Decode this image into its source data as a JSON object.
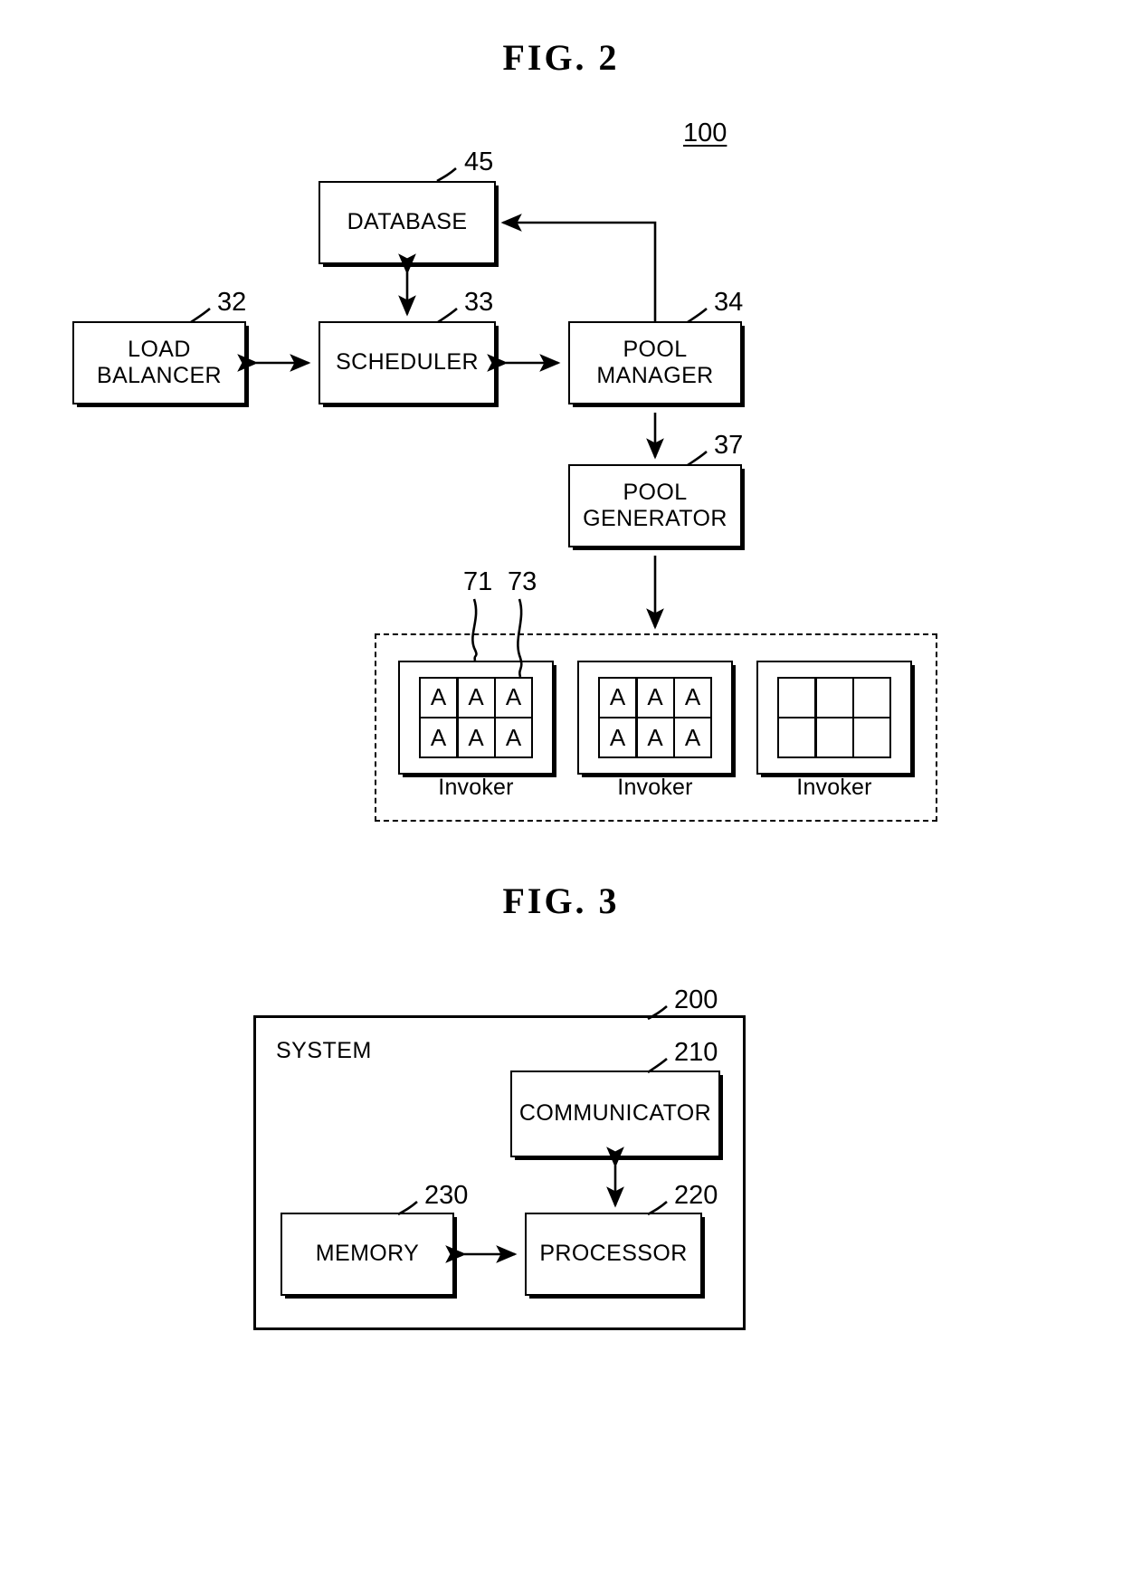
{
  "figures": [
    {
      "title": "FIG.  2",
      "system_ref": "100",
      "blocks": {
        "database": {
          "label": "DATABASE",
          "ref": "45"
        },
        "load_balancer": {
          "label_line1": "LOAD",
          "label_line2": "BALANCER",
          "ref": "32"
        },
        "scheduler": {
          "label": "SCHEDULER",
          "ref": "33"
        },
        "pool_manager": {
          "label_line1": "POOL",
          "label_line2": "MANAGER",
          "ref": "34"
        },
        "pool_generator": {
          "label_line1": "POOL",
          "label_line2": "GENERATOR",
          "ref": "37"
        }
      },
      "pool_zone": {
        "refs": {
          "invoker_ref": "71",
          "container_ref": "73"
        },
        "invokers": [
          {
            "label": "Invoker",
            "cells": [
              "A",
              "A",
              "A",
              "A",
              "A",
              "A"
            ]
          },
          {
            "label": "Invoker",
            "cells": [
              "A",
              "A",
              "A",
              "A",
              "A",
              "A"
            ]
          },
          {
            "label": "Invoker",
            "cells": [
              "",
              "",
              "",
              "",
              "",
              ""
            ]
          }
        ]
      }
    },
    {
      "title": "FIG.  3",
      "blocks": {
        "system": {
          "label": "SYSTEM",
          "ref": "200"
        },
        "communicator": {
          "label": "COMMUNICATOR",
          "ref": "210"
        },
        "processor": {
          "label": "PROCESSOR",
          "ref": "220"
        },
        "memory": {
          "label": "MEMORY",
          "ref": "230"
        }
      }
    }
  ],
  "colors": {
    "ink": "#000000",
    "paper": "#ffffff"
  }
}
